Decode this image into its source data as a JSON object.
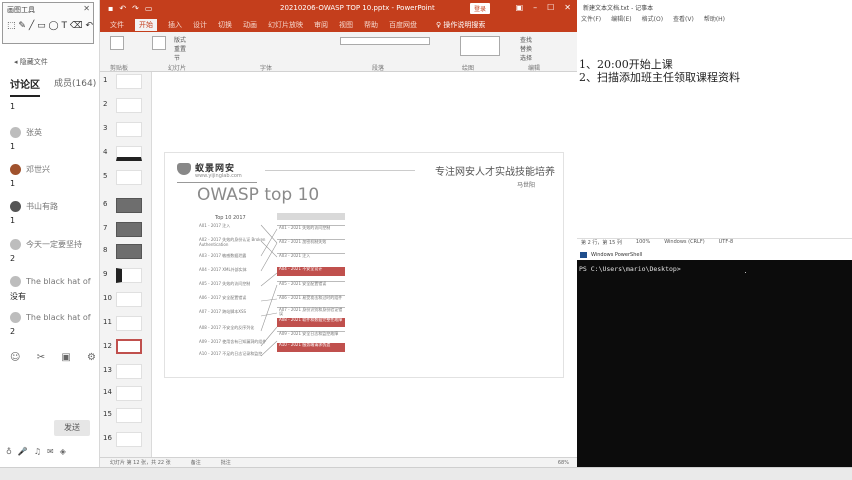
{
  "chat": {
    "toolbox_title": "画图工具",
    "collapse_label": "◂ 隐藏文件",
    "tab_discussion": "讨论区",
    "tab_members": "成员(164)",
    "messages": [
      {
        "name": "",
        "text": "1"
      },
      {
        "name": "张英",
        "text": "1"
      },
      {
        "name": "邓世兴",
        "text": "1"
      },
      {
        "name": "书山有路",
        "text": "1"
      },
      {
        "name": "今天一定要坚持",
        "text": "2"
      },
      {
        "name": "The black hat of",
        "text": "没有"
      },
      {
        "name": "The black hat of",
        "text": "2"
      }
    ],
    "send_label": "发送"
  },
  "ppt": {
    "title": "20210206-OWASP TOP 10.pptx - PowerPoint",
    "login_label": "登录",
    "ribbon_tabs": [
      "文件",
      "开始",
      "插入",
      "设计",
      "切换",
      "动画",
      "幻灯片放映",
      "审阅",
      "视图",
      "帮助",
      "百度网盘"
    ],
    "active_tab": "开始",
    "tell_me": "♀ 操作说明搜索",
    "ribbon_groups": [
      "剪贴板",
      "幻灯片",
      "字体",
      "段落",
      "绘图",
      "编辑"
    ],
    "ribbon_controls": {
      "new_slide": "新建\n幻灯片",
      "layout": "版式",
      "reset": "重置",
      "section": "节",
      "find": "查找",
      "replace": "替换",
      "select": "选择"
    },
    "thumb_numbers": [
      "1",
      "2",
      "3",
      "4",
      "5",
      "6",
      "7",
      "8",
      "9",
      "10",
      "11",
      "12",
      "13",
      "14",
      "15",
      "16"
    ],
    "selected_thumb": 12,
    "slide": {
      "brand": "蚁景网安",
      "brand_sub": "www.yijinglab.com",
      "slogan": "专注网安人才实战技能培养",
      "author": "马世阳",
      "title": "OWASP top 10",
      "left_header": "Top 10 2017",
      "left_items": [
        "A01 - 2017 注入",
        "A02 - 2017 失效的身份认证 Broken Authentication",
        "A03 - 2017 敏感数据泄露",
        "A04 - 2017 XML外部实体",
        "A05 - 2017 失效的访问控制",
        "A06 - 2017 安全配置错误",
        "A07 - 2017 跨站脚本XSS",
        "A08 - 2017 不安全的反序列化",
        "A09 - 2017 使用含有已知漏洞的组件",
        "A10 - 2017 不足的日志记录和监控"
      ],
      "right_items": [
        {
          "text": "A01 - 2021 失效的访问控制",
          "highlight": false
        },
        {
          "text": "A02 - 2021 加密机制失效",
          "highlight": false
        },
        {
          "text": "A03 - 2021 注入",
          "highlight": false
        },
        {
          "text": "A04 - 2021 不安全设计",
          "highlight": true
        },
        {
          "text": "A05 - 2021 安全配置错误",
          "highlight": false
        },
        {
          "text": "A06 - 2021 易受攻击和过时的组件",
          "highlight": false
        },
        {
          "text": "A07 - 2021 身份识别和身份验证错误",
          "highlight": false
        },
        {
          "text": "A08 - 2021 软件和数据完整性故障",
          "highlight": true
        },
        {
          "text": "A09 - 2021 安全日志和监控故障",
          "highlight": false
        },
        {
          "text": "A10 - 2021 服务端请求伪造",
          "highlight": true
        }
      ]
    },
    "status": {
      "slide_pos": "幻灯片 第 12 张，共 22 张",
      "notes": "备注",
      "comments": "批注",
      "zoom": "68%"
    }
  },
  "notepad": {
    "title": "新建文本文档.txt - 记事本",
    "menu": [
      "文件(F)",
      "编辑(E)",
      "格式(O)",
      "查看(V)",
      "帮助(H)"
    ],
    "lines": [
      "1、20:00开始上课",
      "2、扫描添加班主任领取课程资料"
    ],
    "status": [
      "第 2 行，第 15 列",
      "100%",
      "Windows (CRLF)",
      "UTF-8"
    ]
  },
  "powershell": {
    "title": "Windows PowerShell",
    "prompt": "PS C:\\Users\\mario\\Desktop>"
  },
  "colors": {
    "ppt_accent": "#c43e1c",
    "slide_highlight": "#c0504d",
    "terminal_bg": "#0c0c0c"
  }
}
